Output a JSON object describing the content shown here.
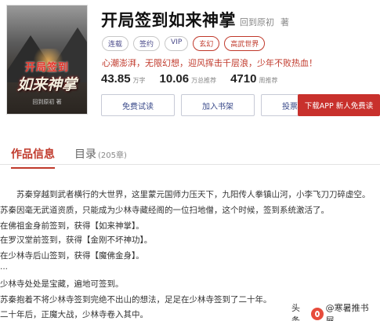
{
  "cover": {
    "top_text": "开局签到",
    "main_text": "如来神掌",
    "author_text": "回到原初 著"
  },
  "book": {
    "title": "开局签到如来神掌",
    "author": "回到原初",
    "author_suffix": "著",
    "tags": [
      "连载",
      "签约",
      "VIP",
      "玄幻",
      "高武世界"
    ],
    "slogan": "心潮澎湃，无限幻想，迎风挥击千层浪，少年不败热血！",
    "stats": [
      {
        "num": "43.85",
        "unit": "万字"
      },
      {
        "num": "10.06",
        "unit": "万总推荐"
      },
      {
        "num": "4710",
        "unit": "周推荐"
      }
    ]
  },
  "actions": {
    "read": "免费试读",
    "shelf": "加入书架",
    "vote": "投票互动",
    "download": "下载APP  新人免费读"
  },
  "tabs": {
    "info": "作品信息",
    "dir": "目录",
    "dir_count": "(205章)"
  },
  "content": [
    "　　苏秦穿越到武者横行的大世界，这里蒙元国师力压天下，九阳传人拳镇山河，小李飞刀刀碎虚空。",
    "苏秦因毫无武道资质，只能成为少林寺藏经阁的一位扫地僧，这个时候，签到系统激活了。",
    "在佛祖金身前签到，获得【如来神掌】。",
    "在罗汉堂前签到，获得【金刚不坏神功】。",
    "在少林寺后山签到，获得【魔佛金身】。",
    "...",
    "少林寺处处是宝藏，遍地可签到。",
    "苏秦抱着不将少林寺签到完绝不出山的想法，足足在少林寺签到了二十年。",
    "二十年后，正魔大战，少林寺卷入其中。"
  ],
  "watermark": {
    "prefix": "头条",
    "handle": "@寒暑推书屋"
  }
}
